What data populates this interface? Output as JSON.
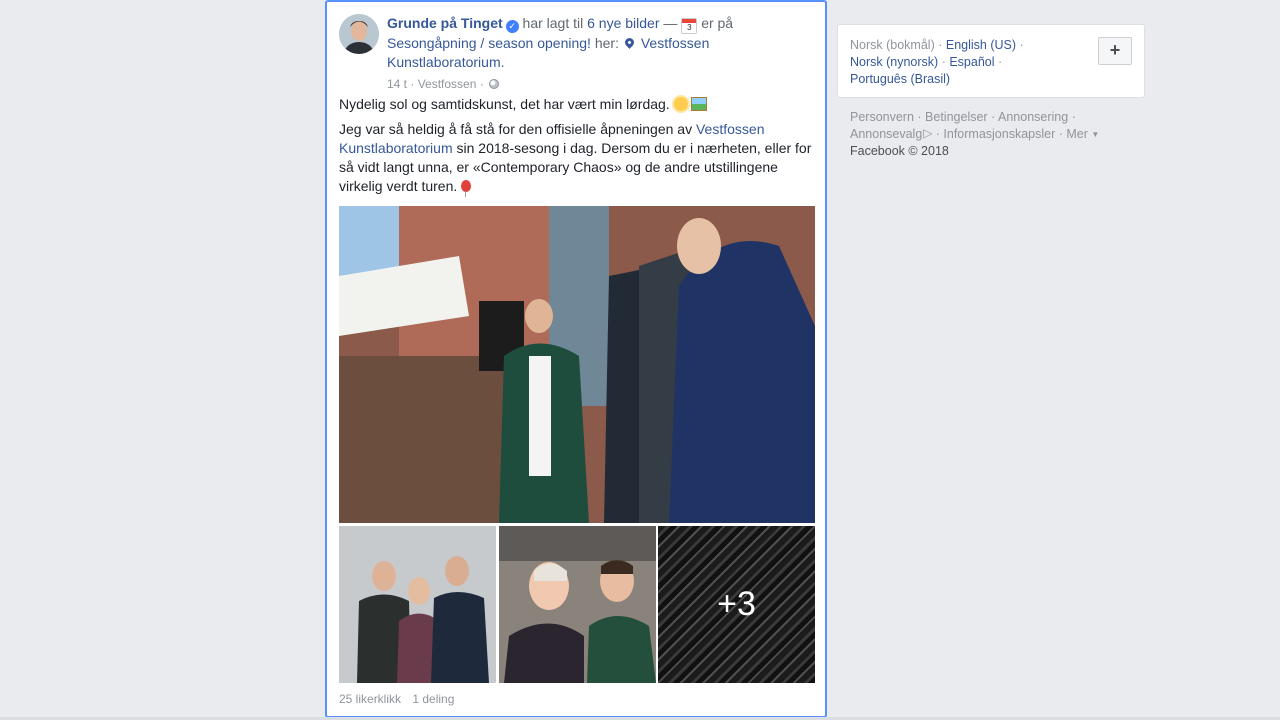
{
  "post": {
    "author": "Grunde på Tinget",
    "action_text": "har lagt til",
    "photos_link": "6 nye bilder",
    "dash": "—",
    "calendar_day": "3",
    "is_at_text": "er på",
    "event_link": "Sesongåpning / season opening!",
    "here_text": "her:",
    "location_link": "Vestfossen Kunstlaboratorium.",
    "time": "14 t",
    "place": "Vestfossen",
    "line1": "Nydelig sol og samtidskunst, det har vært min lørdag.",
    "p2_before": "Jeg var så heldig å få stå for den offisielle åpneningen av",
    "p2_link": "Vestfossen Kunstlaboratorium",
    "p2_after": "sin 2018-sesong i dag. Dersom du er i nærheten, eller for så vidt langt unna, er «Contemporary Chaos» og de andre utstillingene virkelig verdt turen.",
    "more_photos": "+3",
    "likes": "25 likerklikk",
    "shares": "1 deling"
  },
  "sidebar": {
    "lang_current": "Norsk (bokmål)",
    "lang_en": "English (US)",
    "lang_nn": "Norsk (nynorsk)",
    "lang_es": "Español",
    "lang_pt": "Português (Brasil)",
    "plus": "+",
    "privacy": "Personvern",
    "terms": "Betingelser",
    "advertising": "Annonsering",
    "adchoices": "Annonsevalg",
    "cookies": "Informasjonskapsler",
    "more": "Mer",
    "copyright": "Facebook © 2018"
  },
  "colors": {
    "link": "#365899",
    "highlight_border": "#5890ff",
    "background": "#e9ebee"
  },
  "icons": [
    "verified-icon",
    "calendar-icon",
    "location-pin-icon",
    "globe-icon",
    "sun-emoji-icon",
    "picture-emoji-icon",
    "balloon-emoji-icon",
    "adchoices-icon"
  ]
}
